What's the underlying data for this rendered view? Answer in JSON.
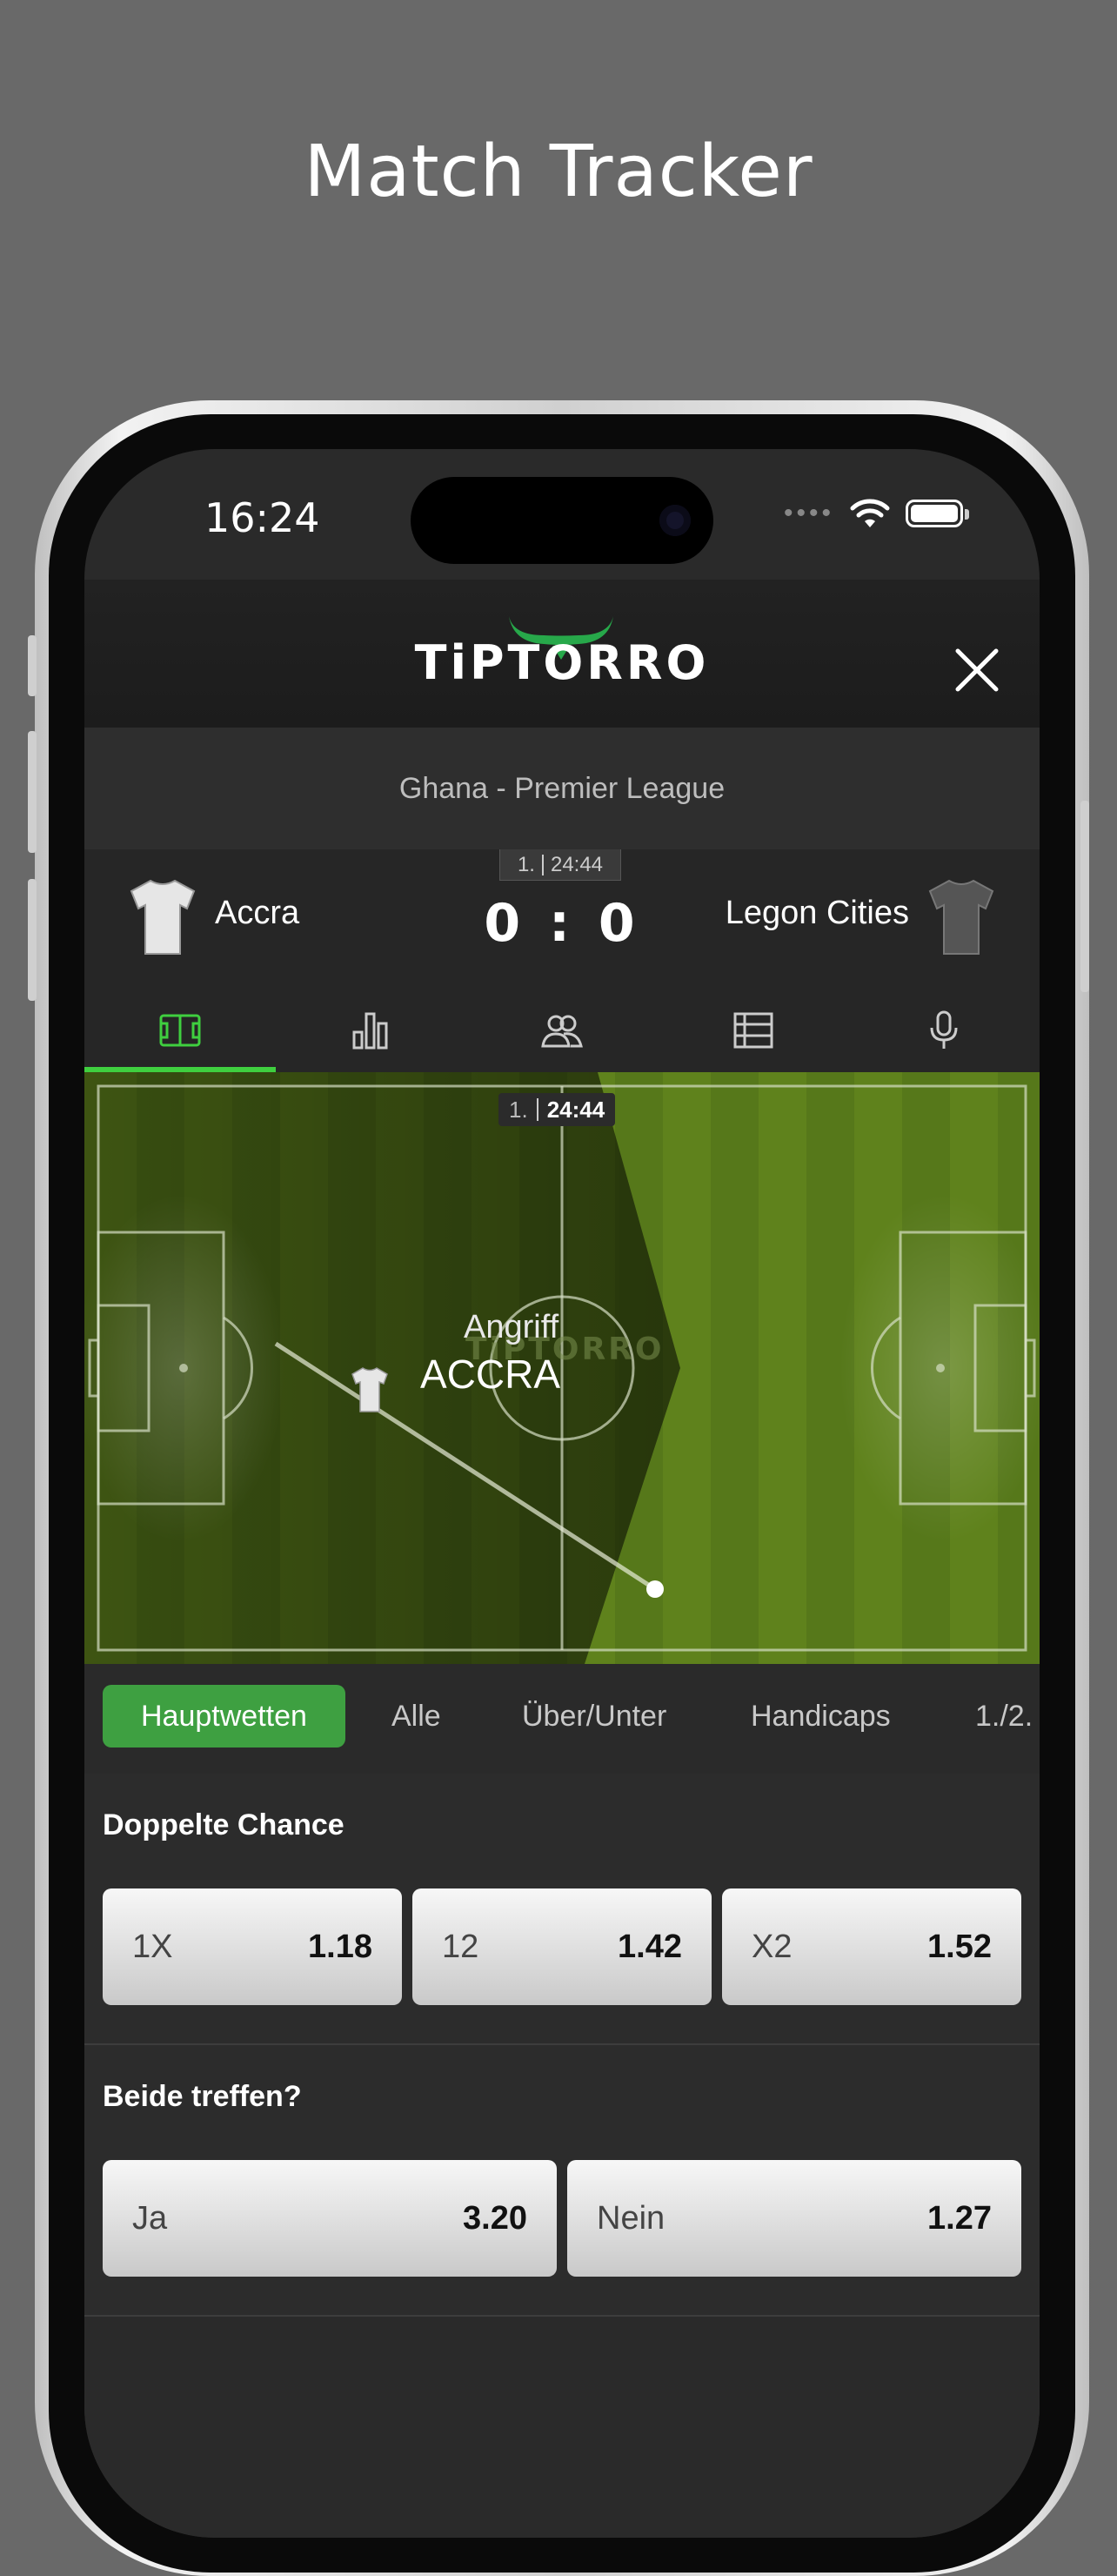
{
  "promo": {
    "title": "Match Tracker"
  },
  "status_bar": {
    "time": "16:24"
  },
  "header": {
    "logo_text": "TiPTORRO"
  },
  "league": "Ghana - Premier League",
  "match": {
    "period": "1.",
    "clock": "24:44",
    "home_team": "Accra",
    "away_team": "Legon Cities",
    "score": "0 : 0"
  },
  "tracker": {
    "period": "1.",
    "clock": "24:44",
    "event_label": "Angriff",
    "event_team": "ACCRA",
    "watermark": "TiPTORRO"
  },
  "tabs": [
    {
      "icon": "pitch-icon",
      "active": true
    },
    {
      "icon": "bar-chart-icon",
      "active": false
    },
    {
      "icon": "lineup-icon",
      "active": false
    },
    {
      "icon": "table-icon",
      "active": false
    },
    {
      "icon": "microphone-icon",
      "active": false
    }
  ],
  "market_tabs": [
    "Hauptwetten",
    "Alle",
    "Über/Unter",
    "Handicaps",
    "1./2."
  ],
  "markets": [
    {
      "title": "Doppelte Chance",
      "odds": [
        {
          "label": "1X",
          "value": "1.18"
        },
        {
          "label": "12",
          "value": "1.42"
        },
        {
          "label": "X2",
          "value": "1.52"
        }
      ]
    },
    {
      "title": "Beide treffen?",
      "odds": [
        {
          "label": "Ja",
          "value": "3.20"
        },
        {
          "label": "Nein",
          "value": "1.27"
        }
      ]
    }
  ],
  "colors": {
    "accent_green": "#3fcf3f",
    "active_tab_bg": "#3ea041",
    "pitch_green": "#587a18"
  }
}
